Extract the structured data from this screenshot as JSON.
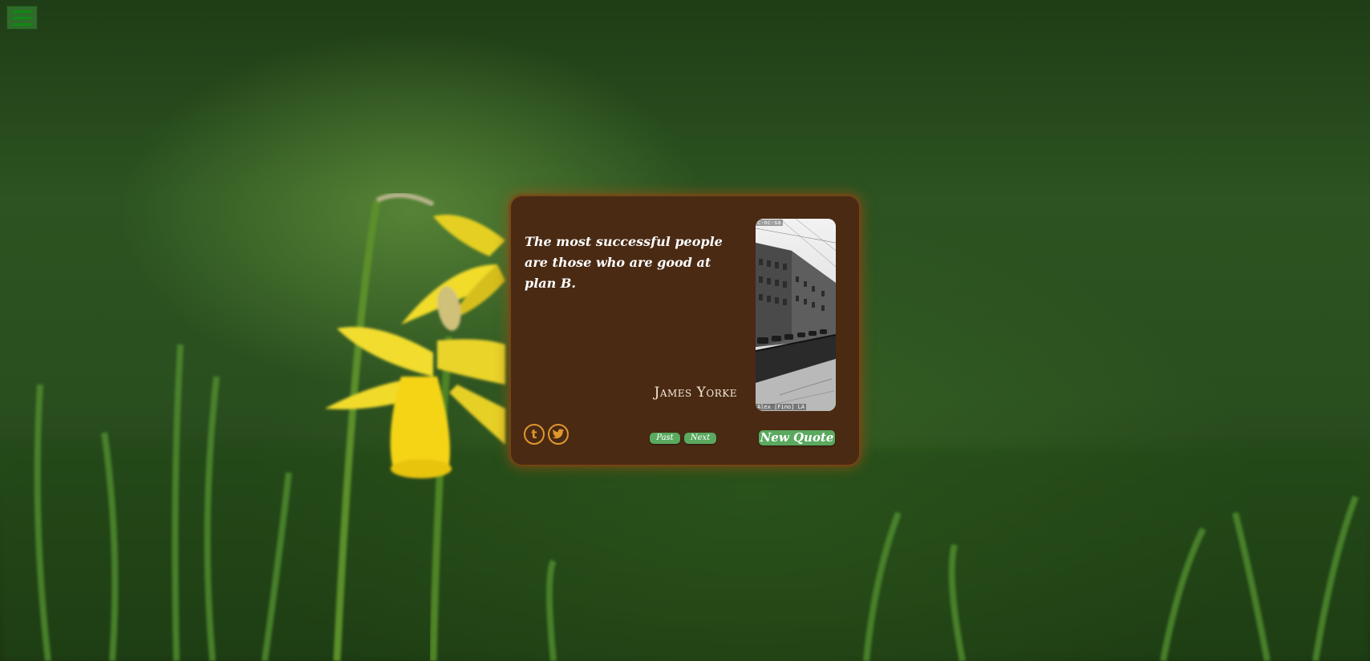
{
  "menu": {
    "icon": "hamburger-menu-icon",
    "color": "#0f8a13"
  },
  "quote": {
    "text": "The most successful people are those who are good at plan B.",
    "author": "James Yorke"
  },
  "photo": {
    "credit_top": "c-nc-sa",
    "credit_bottom": "Alex [Fino] LA"
  },
  "share": {
    "tumblr_icon": "tumblr-icon",
    "tumblr_glyph": "t",
    "twitter_icon": "twitter-icon"
  },
  "controls": {
    "past_label": "Past",
    "next_label": "Next",
    "new_quote_label": "New Quote"
  },
  "colors": {
    "card": "#4a2a13",
    "button": "#5aa95f",
    "accent": "#e0962e"
  }
}
